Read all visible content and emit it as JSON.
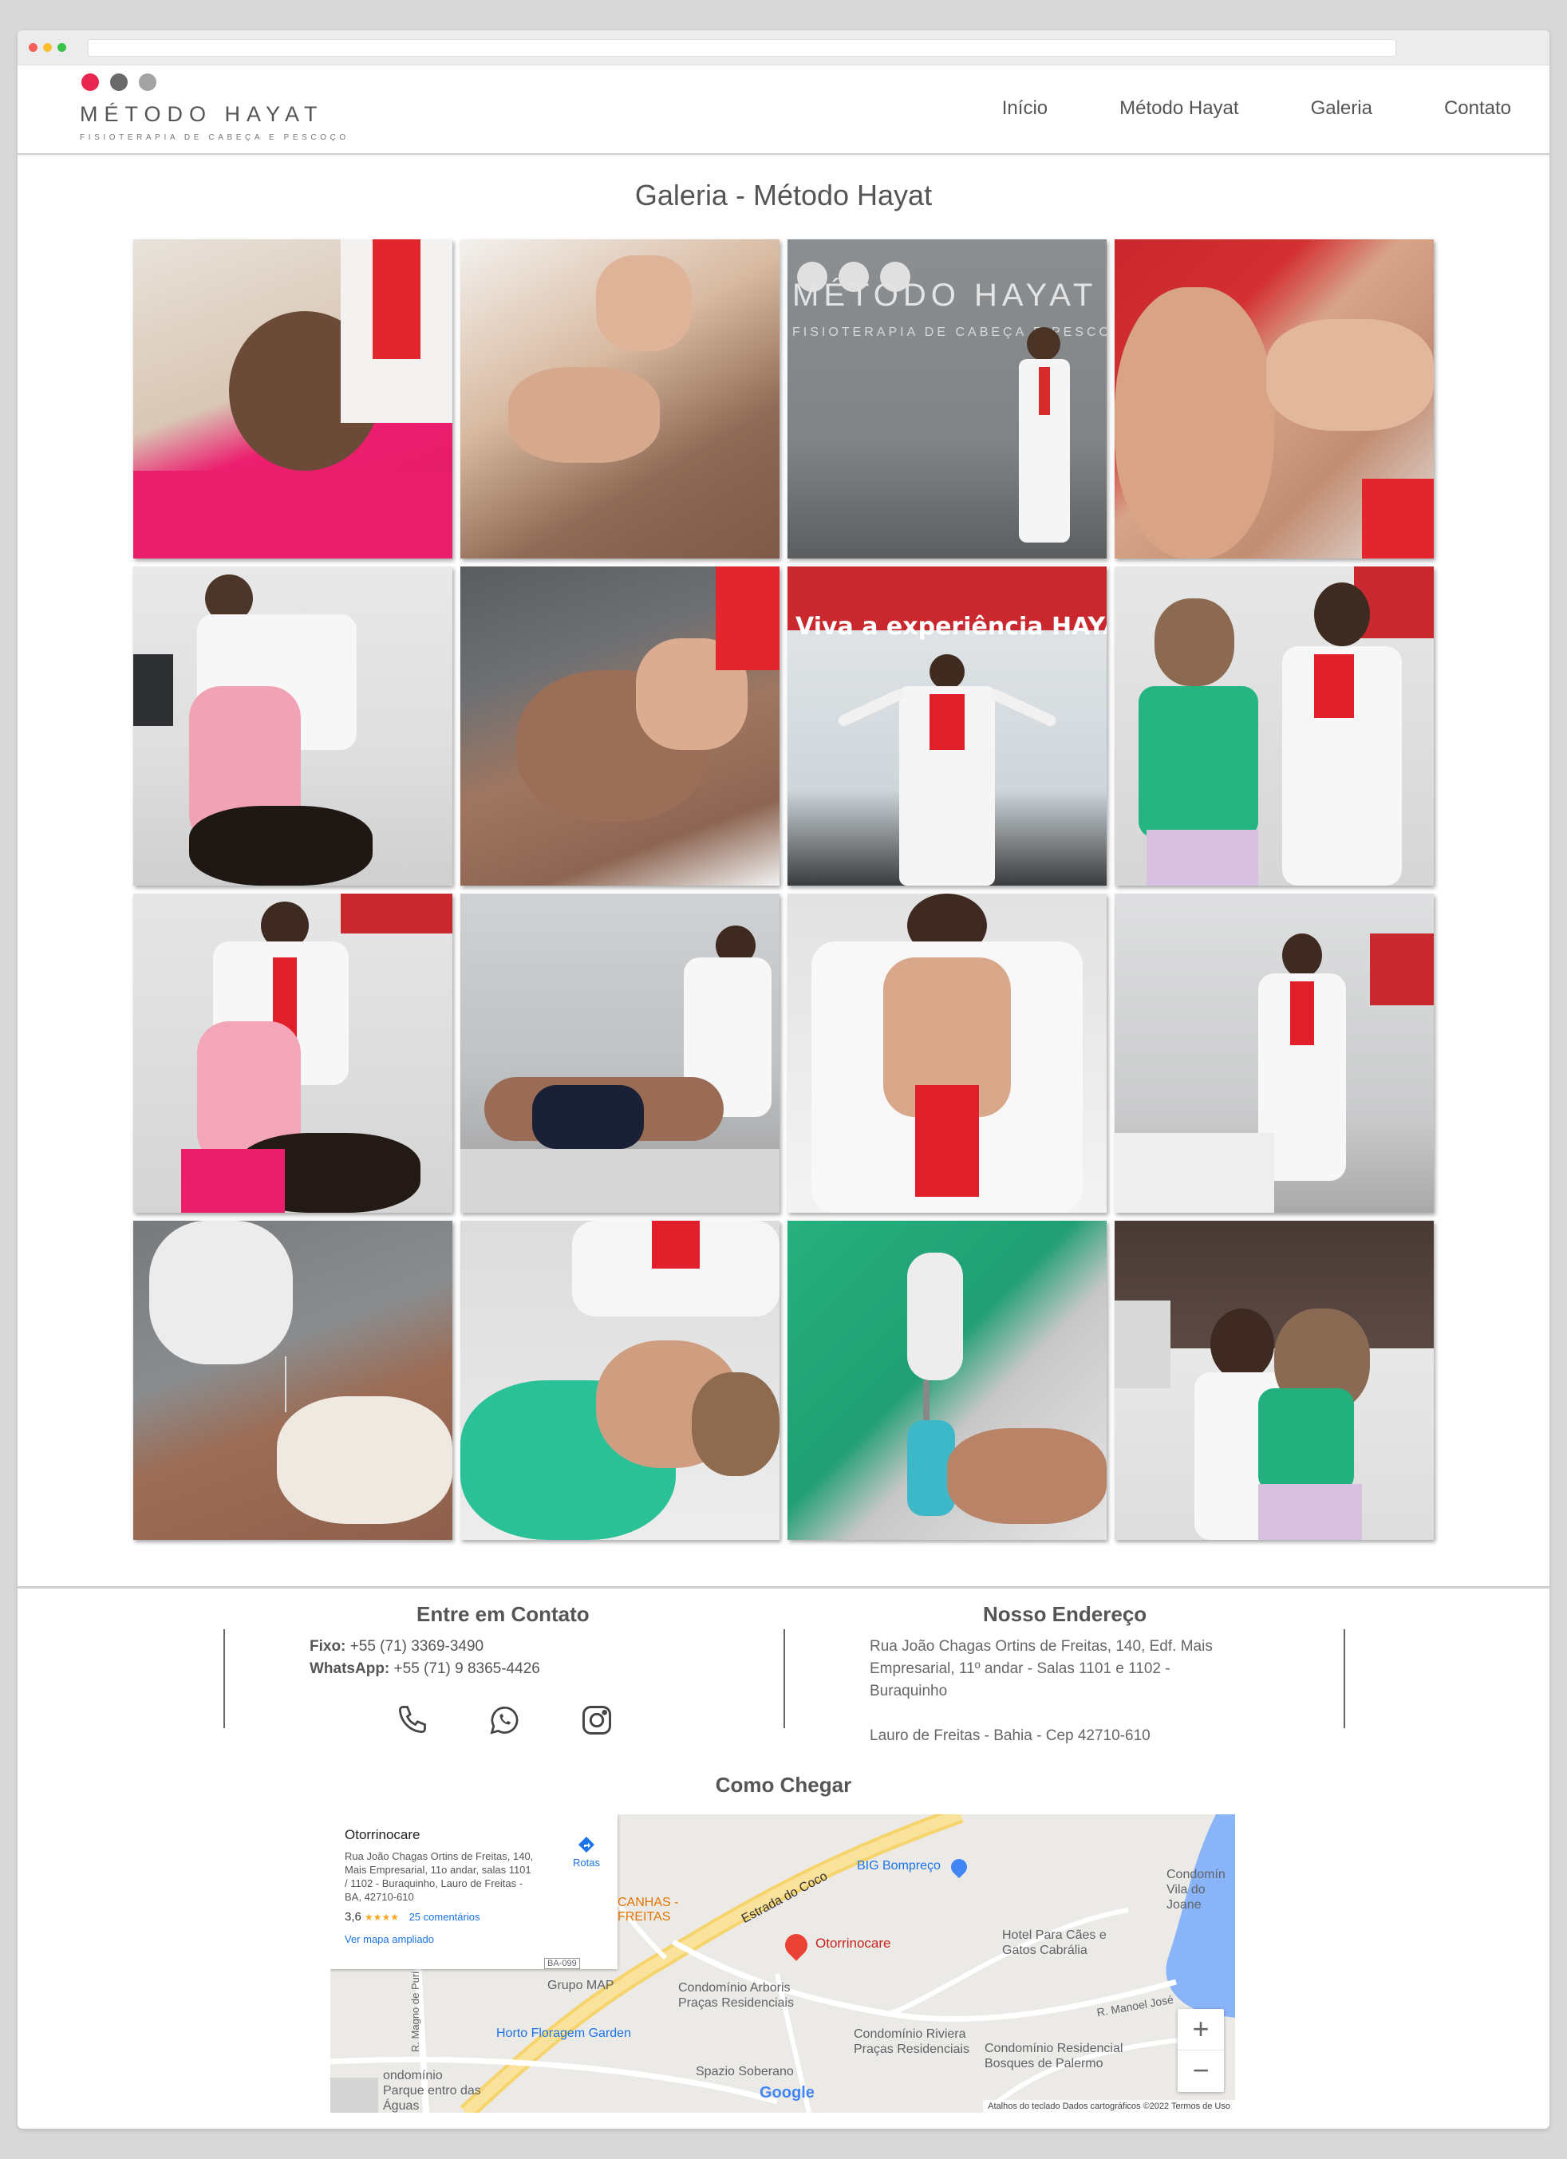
{
  "header": {
    "logo_title": "MÉTODO HAYAT",
    "logo_subtitle": "FISIOTERAPIA DE CABEÇA E PESCOÇO",
    "logo_dot_colors": [
      "#e8264f",
      "#6a6a6a",
      "#a3a3a3"
    ],
    "nav": [
      "Início",
      "Método Hayat",
      "Galeria",
      "Contato"
    ]
  },
  "gallery": {
    "title": "Galeria - Método Hayat",
    "photos": [
      {
        "icon": "photo-child-head-therapy"
      },
      {
        "icon": "photo-hands-on-chest"
      },
      {
        "icon": "photo-therapist-logo-wall",
        "wall_title": "MÉTODO HAYAT",
        "wall_subtitle": "FISIOTERAPIA DE CABEÇA E PESCOÇO"
      },
      {
        "icon": "photo-ear-treatment"
      },
      {
        "icon": "photo-child-legs-exercise"
      },
      {
        "icon": "photo-man-face-massage"
      },
      {
        "icon": "photo-therapist-open-arms",
        "caption": "Viva a experiência HAYAT"
      },
      {
        "icon": "photo-two-women-device"
      },
      {
        "icon": "photo-child-pink-therapy"
      },
      {
        "icon": "photo-man-leg-stretch"
      },
      {
        "icon": "photo-hands-crossed-closeup"
      },
      {
        "icon": "photo-therapist-standing-room"
      },
      {
        "icon": "photo-acupuncture-needle"
      },
      {
        "icon": "photo-woman-neck-massage"
      },
      {
        "icon": "photo-wrist-device"
      },
      {
        "icon": "photo-two-women-hug"
      }
    ]
  },
  "contact": {
    "title": "Entre em Contato",
    "phone_label": "Fixo:",
    "phone": " +55 (71) 3369-3490",
    "whatsapp_label": "WhatsApp:",
    "whatsapp": " +55 (71) 9 8365-4426"
  },
  "address": {
    "title": "Nosso Endereço",
    "line1": "Rua João Chagas Ortins de Freitas, 140, Edf. Mais Empresarial, 11º andar - Salas 1101 e 1102 - Buraquinho",
    "line2": "Lauro de Freitas - Bahia - Cep 42710-610"
  },
  "directions": {
    "title": "Como Chegar"
  },
  "map": {
    "place": "Otorrinocare",
    "place_address": "Rua João Chagas Ortins de Freitas, 140, Mais Empresarial, 11o andar, salas 1101 / 1102 - Buraquinho, Lauro de Freitas - BA, 42710-610",
    "rating": "3,6",
    "stars": "★★★★",
    "reviews": "25 comentários",
    "enlarge": "Ver mapa ampliado",
    "directions_btn": "Rotas",
    "pin_label": "Otorrinocare",
    "labels": [
      "BIG Bompreço",
      "Estrada do Coco",
      "CANHAS - FREITAS",
      "Hotel Para Cães e Gatos Cabrália",
      "Grupo MAP",
      "Condomínio Arboris Praças Residenciais",
      "Horto Floragem Garden",
      "Condomínio Riviera Praças Residenciais",
      "Condomínio Residencial Bosques de Palermo",
      "Spazio Soberano",
      "ondomínio Parque entro das Águas",
      "R. Manoel José",
      "Condomín Vila do Joane",
      "R. Magno de Puri",
      "BA-099"
    ],
    "zoom_in": "+",
    "zoom_out": "−",
    "google": "Google",
    "attribution": "Atalhos do teclado    Dados cartográficos ©2022    Termos de Uso"
  }
}
